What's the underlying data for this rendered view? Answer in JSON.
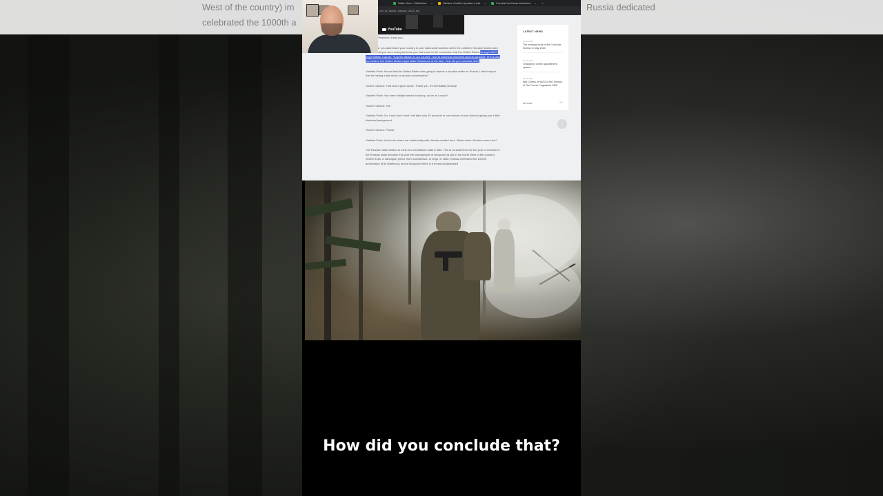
{
  "background_text": {
    "left": "West of the country) im celebrated the 1000th a",
    "right": "Russia dedicated"
  },
  "browser": {
    "tabs": [
      {
        "label": "Strike Sum • StrikeSum",
        "color": "#34a853"
      },
      {
        "label": "Ukraine Conflict Updates | Inst",
        "color": "#f4b400"
      },
      {
        "label": "Combat Vet News Members",
        "color": "#34a853"
      }
    ],
    "new_tab": "+",
    "url": "ren_to_tucker_carlson_2024_en/"
  },
  "embed": {
    "logo": "YouTube"
  },
  "article": {
    "paragraphs": [
      {
        "pre": "ilson: Mr. President, thank you.",
        "hl": "",
        "post": ""
      },
      {
        "pre": "ry 22, 2022, you addressed your country in your nationwide address when the conflict in Ukraine started and you said that you were acting because you had come to the conclusion that the United States ",
        "hl": "through NATO might initiate a quote, \"surprise attack on our country\". And to American ears that sounds paranoid. Tell us why you believe the United States might strike Russia out of the blue. How did you conclude that?",
        "post": ""
      },
      {
        "pre": "Vladimir Putin: It's not that the United States was going to launch a surprise strike on Russia. I didn't say so. Are we having a talk show or serious conversation?",
        "hl": "",
        "post": ""
      },
      {
        "pre": "Tucker Carlson: That was a good quote. Thank you, it's formidably serious!",
        "hl": "",
        "post": ""
      },
      {
        "pre": "Vladimir Putin: You were initially trained in history, as far as I know?",
        "hl": "",
        "post": ""
      },
      {
        "pre": "Tucker Carlson: Yes.",
        "hl": "",
        "post": ""
      },
      {
        "pre": "Vladimir Putin: So, if you don't mind I will take only 30 seconds or one minute of your time for giving you a little historical background.",
        "hl": "",
        "post": ""
      },
      {
        "pre": "Tucker Carlson: Please.",
        "hl": "",
        "post": ""
      },
      {
        "pre": "Vladimir Putin: Let's look where our relationship with Ukraine started from. Where does Ukraine come from?",
        "hl": "",
        "post": ""
      },
      {
        "pre": "The Russian state started to exist as a centralized state in 862. This is considered to be the year of creation of the Russian state because this year the townspeople of Novgorod (a city in the North West of the country) invited Rurik, a Varangian prince from Scandinavia, to reign. In 1862, Russia celebrated the 1000th anniversary of its statehood, and in Novgorod there is a memorial dedicated",
        "hl": "",
        "post": ""
      }
    ]
  },
  "sidebar": {
    "heading": "LATEST NEWS",
    "items": [
      {
        "date": "01.09.2024",
        "title": "The working hours of the Consular Section in May 2024"
      },
      {
        "date": "01.09.2024",
        "title": "Changes in online appointment system"
      },
      {
        "date": "01.09.2024",
        "title": "War Crimes of NATO in the Territory of The Former Yugoslavia 1999"
      }
    ],
    "all_news": "All news",
    "arrow": "→",
    "to_top": "↑"
  },
  "caption": {
    "text": "How did you conclude that?"
  }
}
